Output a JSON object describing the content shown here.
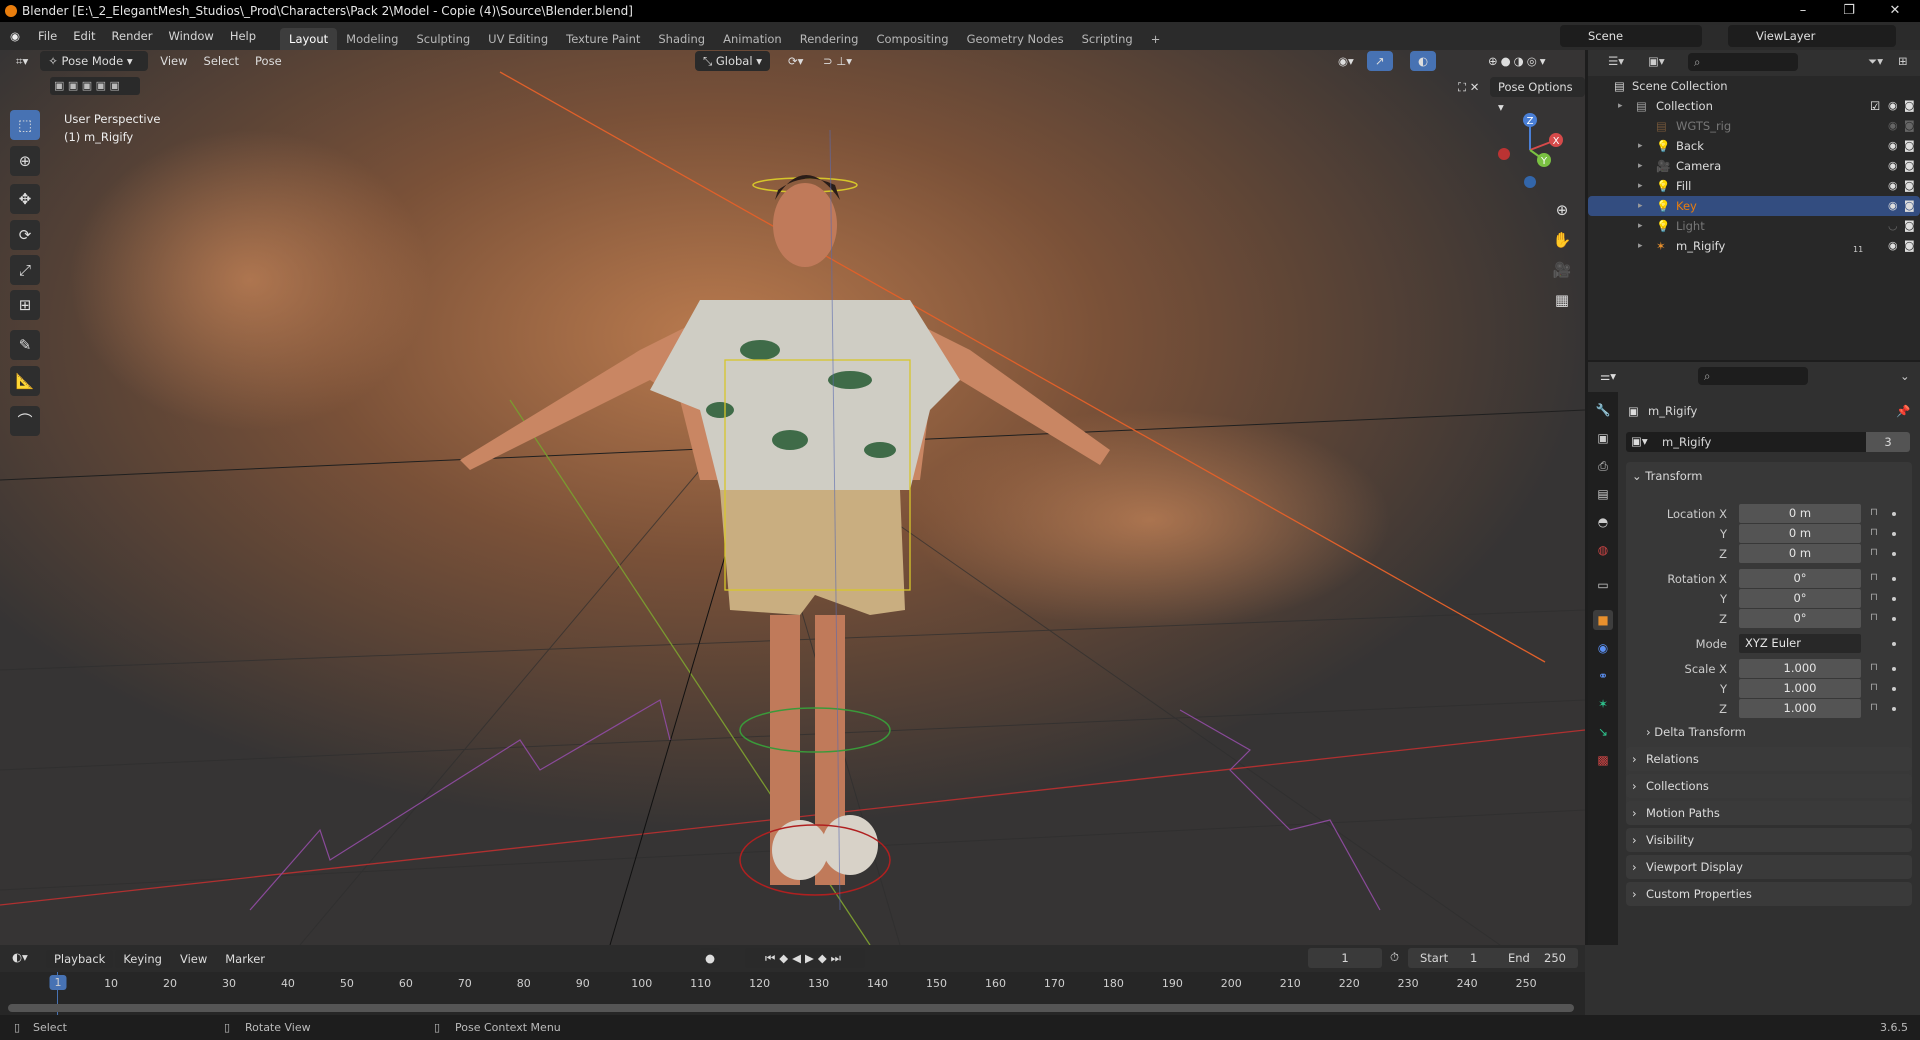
{
  "window": {
    "title": "Blender [E:\\_2_ElegantMesh_Studios\\_Prod\\Characters\\Pack 2\\Model - Copie (4)\\Source\\Blender.blend]",
    "minimize": "–",
    "maximize": "❐",
    "close": "✕"
  },
  "menus": [
    "File",
    "Edit",
    "Render",
    "Window",
    "Help"
  ],
  "workspaces": [
    "Layout",
    "Modeling",
    "Sculpting",
    "UV Editing",
    "Texture Paint",
    "Shading",
    "Animation",
    "Rendering",
    "Compositing",
    "Geometry Nodes",
    "Scripting",
    "+"
  ],
  "scene": {
    "name": "Scene",
    "view_layer": "ViewLayer"
  },
  "viewport": {
    "mode": "Pose Mode",
    "menus": [
      "View",
      "Select",
      "Pose"
    ],
    "orientation": "Global",
    "pose_options": "Pose Options",
    "perspective": "User Perspective",
    "object": "(1) m_Rigify",
    "gizmo_axes": {
      "x": "X",
      "y": "Y",
      "z": "Z"
    }
  },
  "colors": {
    "accent": "#4772b3",
    "selected_row": "#334d80",
    "active_text": "#e87d0d",
    "bg": "#303030"
  },
  "outliner": {
    "root": "Scene Collection",
    "items": [
      {
        "name": "Collection",
        "level": 0,
        "icon": "collection",
        "dim": false,
        "selected": false
      },
      {
        "name": "WGTS_rig",
        "level": 1,
        "icon": "collection",
        "dim": true,
        "selected": false
      },
      {
        "name": "Back",
        "level": 1,
        "icon": "light",
        "dim": false,
        "selected": false
      },
      {
        "name": "Camera",
        "level": 1,
        "icon": "camera",
        "dim": false,
        "selected": false
      },
      {
        "name": "Fill",
        "level": 1,
        "icon": "light",
        "dim": false,
        "selected": false
      },
      {
        "name": "Key",
        "level": 1,
        "icon": "light",
        "dim": false,
        "selected": true
      },
      {
        "name": "Light",
        "level": 1,
        "icon": "light",
        "dim": true,
        "selected": false
      },
      {
        "name": "m_Rigify",
        "level": 1,
        "icon": "armature",
        "dim": false,
        "selected": false
      }
    ],
    "rigify_badge": "11"
  },
  "properties": {
    "object_name": "m_Rigify",
    "data_name": "m_Rigify",
    "users": "3",
    "transform_label": "Transform",
    "rows": [
      {
        "label": "Location X",
        "value": "0 m"
      },
      {
        "label": "Y",
        "value": "0 m"
      },
      {
        "label": "Z",
        "value": "0 m"
      },
      {
        "label": "Rotation X",
        "value": "0°"
      },
      {
        "label": "Y",
        "value": "0°"
      },
      {
        "label": "Z",
        "value": "0°"
      },
      {
        "label": "Mode",
        "value": "XYZ Euler"
      },
      {
        "label": "Scale X",
        "value": "1.000"
      },
      {
        "label": "Y",
        "value": "1.000"
      },
      {
        "label": "Z",
        "value": "1.000"
      }
    ],
    "sub_panel": "Delta Transform",
    "panels": [
      "Relations",
      "Collections",
      "Motion Paths",
      "Visibility",
      "Viewport Display",
      "Custom Properties"
    ]
  },
  "timeline": {
    "menus": [
      "Playback",
      "Keying",
      "View",
      "Marker"
    ],
    "current_frame": "1",
    "start_label": "Start",
    "start": "1",
    "end_label": "End",
    "end": "250",
    "ticks": [
      "1",
      "10",
      "20",
      "30",
      "40",
      "50",
      "60",
      "70",
      "80",
      "90",
      "100",
      "110",
      "120",
      "130",
      "140",
      "150",
      "160",
      "170",
      "180",
      "190",
      "200",
      "210",
      "220",
      "230",
      "240",
      "250"
    ]
  },
  "status": {
    "items": [
      "Select",
      "Rotate View",
      "Pose Context Menu"
    ],
    "version": "3.6.5"
  }
}
